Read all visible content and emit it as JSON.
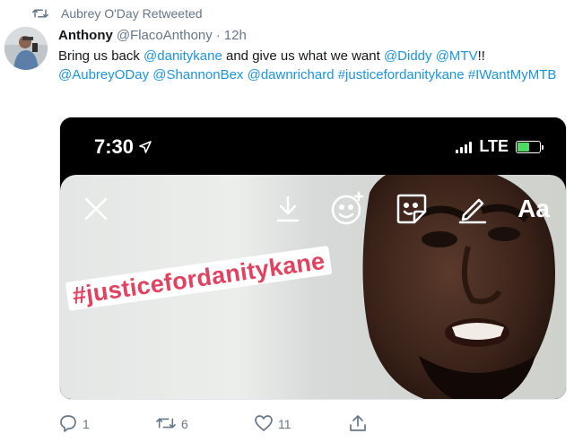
{
  "retweet_banner": {
    "label": "Aubrey O'Day Retweeted",
    "icon": "retweet-icon"
  },
  "tweet": {
    "author_name": "Anthony",
    "author_handle": "@FlacoAnthony",
    "separator": "·",
    "time": "12h",
    "text": [
      {
        "text": "Bring us back ",
        "link": false
      },
      {
        "text": "@danitykane",
        "link": true
      },
      {
        "text": " and give us what we want ",
        "link": false
      },
      {
        "text": "@Diddy",
        "link": true
      },
      {
        "text": " ",
        "link": false
      },
      {
        "text": "@MTV",
        "link": true
      },
      {
        "text": "!! ",
        "link": false
      },
      {
        "text": "@AubreyODay",
        "link": true
      },
      {
        "text": " ",
        "link": false
      },
      {
        "text": "@ShannonBex",
        "link": true
      },
      {
        "text": " ",
        "link": false
      },
      {
        "text": "@dawnrichard",
        "link": true
      },
      {
        "text": " ",
        "link": false
      },
      {
        "text": "#justicefordanitykane",
        "link": true
      },
      {
        "text": " ",
        "link": false
      },
      {
        "text": "#IWantMyMTB",
        "link": true
      }
    ],
    "link_color": "#1b95e0"
  },
  "media": {
    "status_time": "7:30",
    "network": "LTE",
    "battery_level": 0.55,
    "hashtag_sticker": "#justicefordanitykane",
    "text_tool_label": "Aa",
    "story_tools": [
      "close-icon",
      "download-icon",
      "sticker-icon",
      "face-filter-icon",
      "draw-icon",
      "text-tool"
    ]
  },
  "actions": {
    "reply_count": "1",
    "retweet_count": "6",
    "like_count": "11",
    "icons": [
      "reply-icon",
      "retweet-icon",
      "like-icon",
      "share-icon"
    ]
  }
}
